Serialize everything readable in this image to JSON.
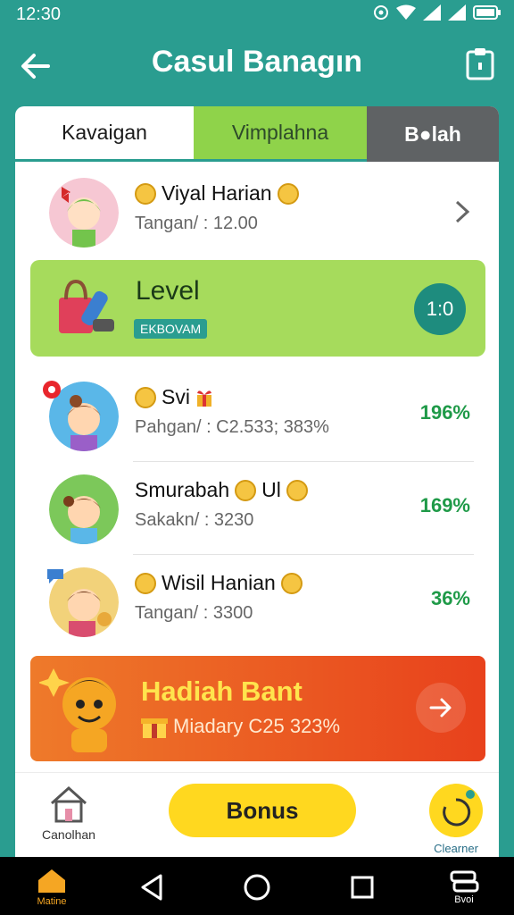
{
  "status_bar": {
    "time": "12:30"
  },
  "header": {
    "title": "Casul Banagın"
  },
  "tabs": [
    {
      "label": "Kavaigan"
    },
    {
      "label": "Vimplahna"
    },
    {
      "label": "B●lah"
    }
  ],
  "rows": [
    {
      "title": "Viyal Harian",
      "subtitle": "Tangan/ : 12.00",
      "percent": ""
    },
    {
      "title": "Svi",
      "subtitle": "Pahgan/ : C2.533; 383%",
      "percent": "196%"
    },
    {
      "title": "Smurabah",
      "title_suffix": "Ul",
      "subtitle": "Sakakn/ : 3230",
      "percent": "169%"
    },
    {
      "title": "Wisil Hanian",
      "subtitle": "Tangan/ : 3300",
      "percent": "36%"
    }
  ],
  "level_card": {
    "title": "Level",
    "badge": "EKBOVAM",
    "count": "1:0"
  },
  "promo": {
    "title": "Hadiah Bant",
    "subtitle": "Miadary C25 323%"
  },
  "bottom": {
    "left_label": "Canolhan",
    "bonus_label": "Bonus",
    "right_label": "Clearner"
  },
  "nav": {
    "home_label": "Matine",
    "right_label": "Bvoi"
  },
  "colors": {
    "teal": "#2a9d90",
    "green": "#a6db5c",
    "orange": "#e8411c",
    "yellow": "#ffd81f"
  }
}
